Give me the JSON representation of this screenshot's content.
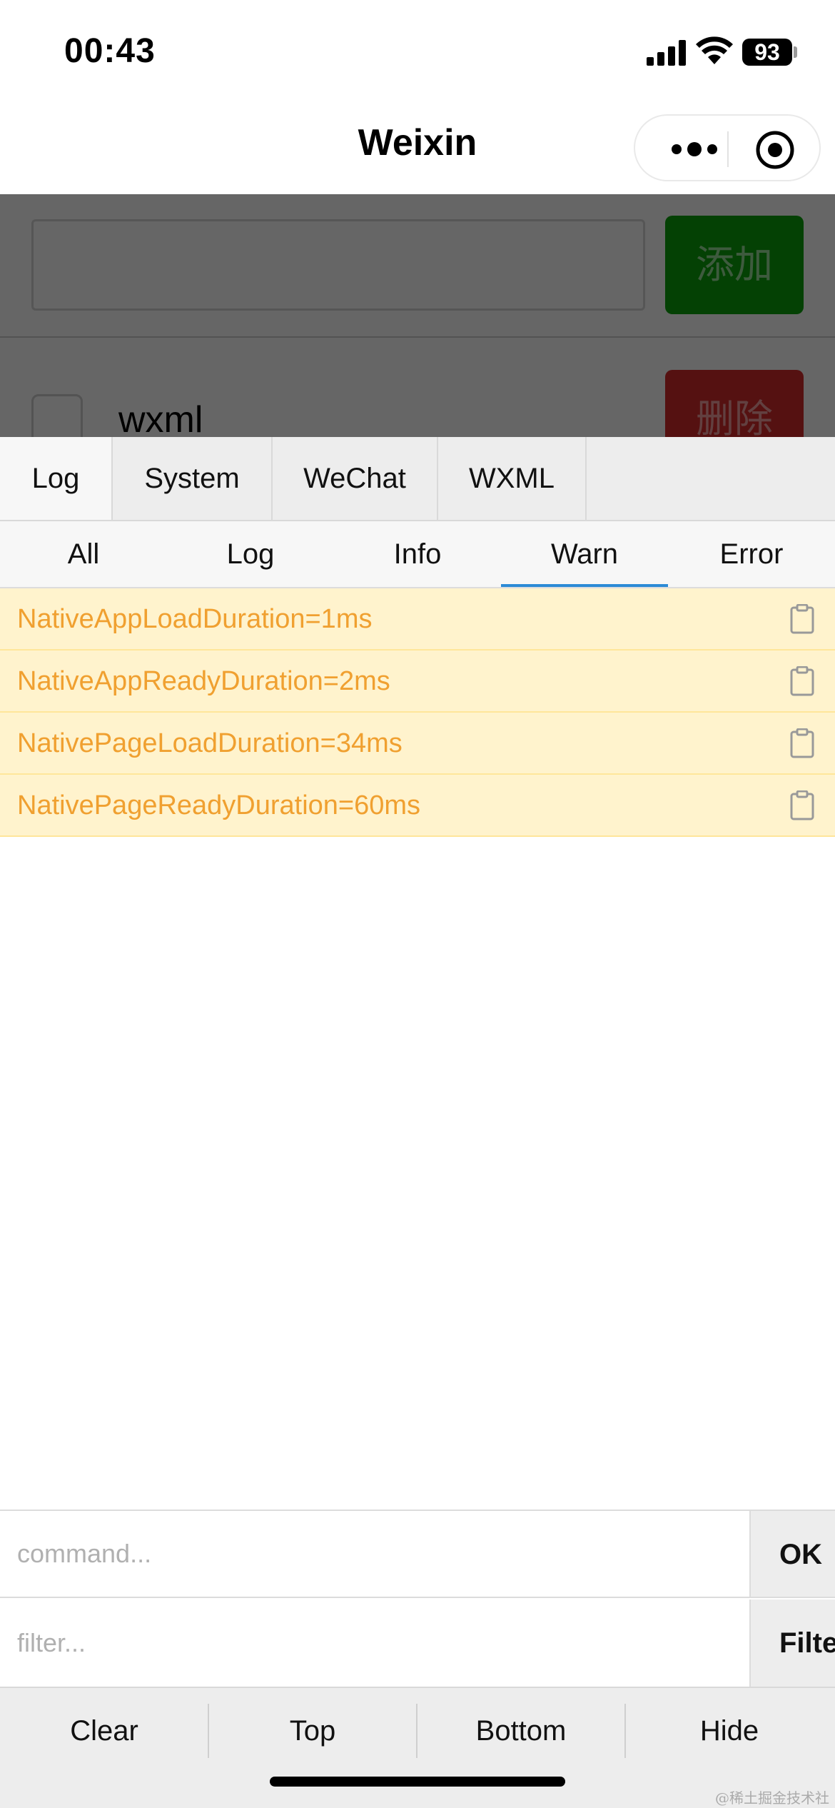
{
  "status_bar": {
    "time": "00:43",
    "battery": "93"
  },
  "nav": {
    "title": "Weixin",
    "more_icon": "more-dots-icon",
    "close_icon": "target-close-icon"
  },
  "page": {
    "add_button": "添加",
    "delete_button": "删除",
    "item_text": "wxml"
  },
  "vconsole": {
    "main_tabs": [
      "Log",
      "System",
      "WeChat",
      "WXML"
    ],
    "sub_tabs": [
      "All",
      "Log",
      "Info",
      "Warn",
      "Error"
    ],
    "active_sub_tab": "Warn",
    "logs": [
      "NativeAppLoadDuration=1ms",
      "NativeAppReadyDuration=2ms",
      "NativePageLoadDuration=34ms",
      "NativePageReadyDuration=60ms"
    ],
    "command_placeholder": "command...",
    "filter_placeholder": "filter...",
    "ok_button": "OK",
    "filter_button": "Filter",
    "toolbar": [
      "Clear",
      "Top",
      "Bottom",
      "Hide"
    ]
  },
  "watermark": "@稀土掘金技术社区",
  "colors": {
    "warn_bg": "#fff3cd",
    "warn_text": "#f0a030",
    "active_tab_line": "#2c8bd6",
    "add": "#0aa40a",
    "delete": "#d42b2b"
  }
}
